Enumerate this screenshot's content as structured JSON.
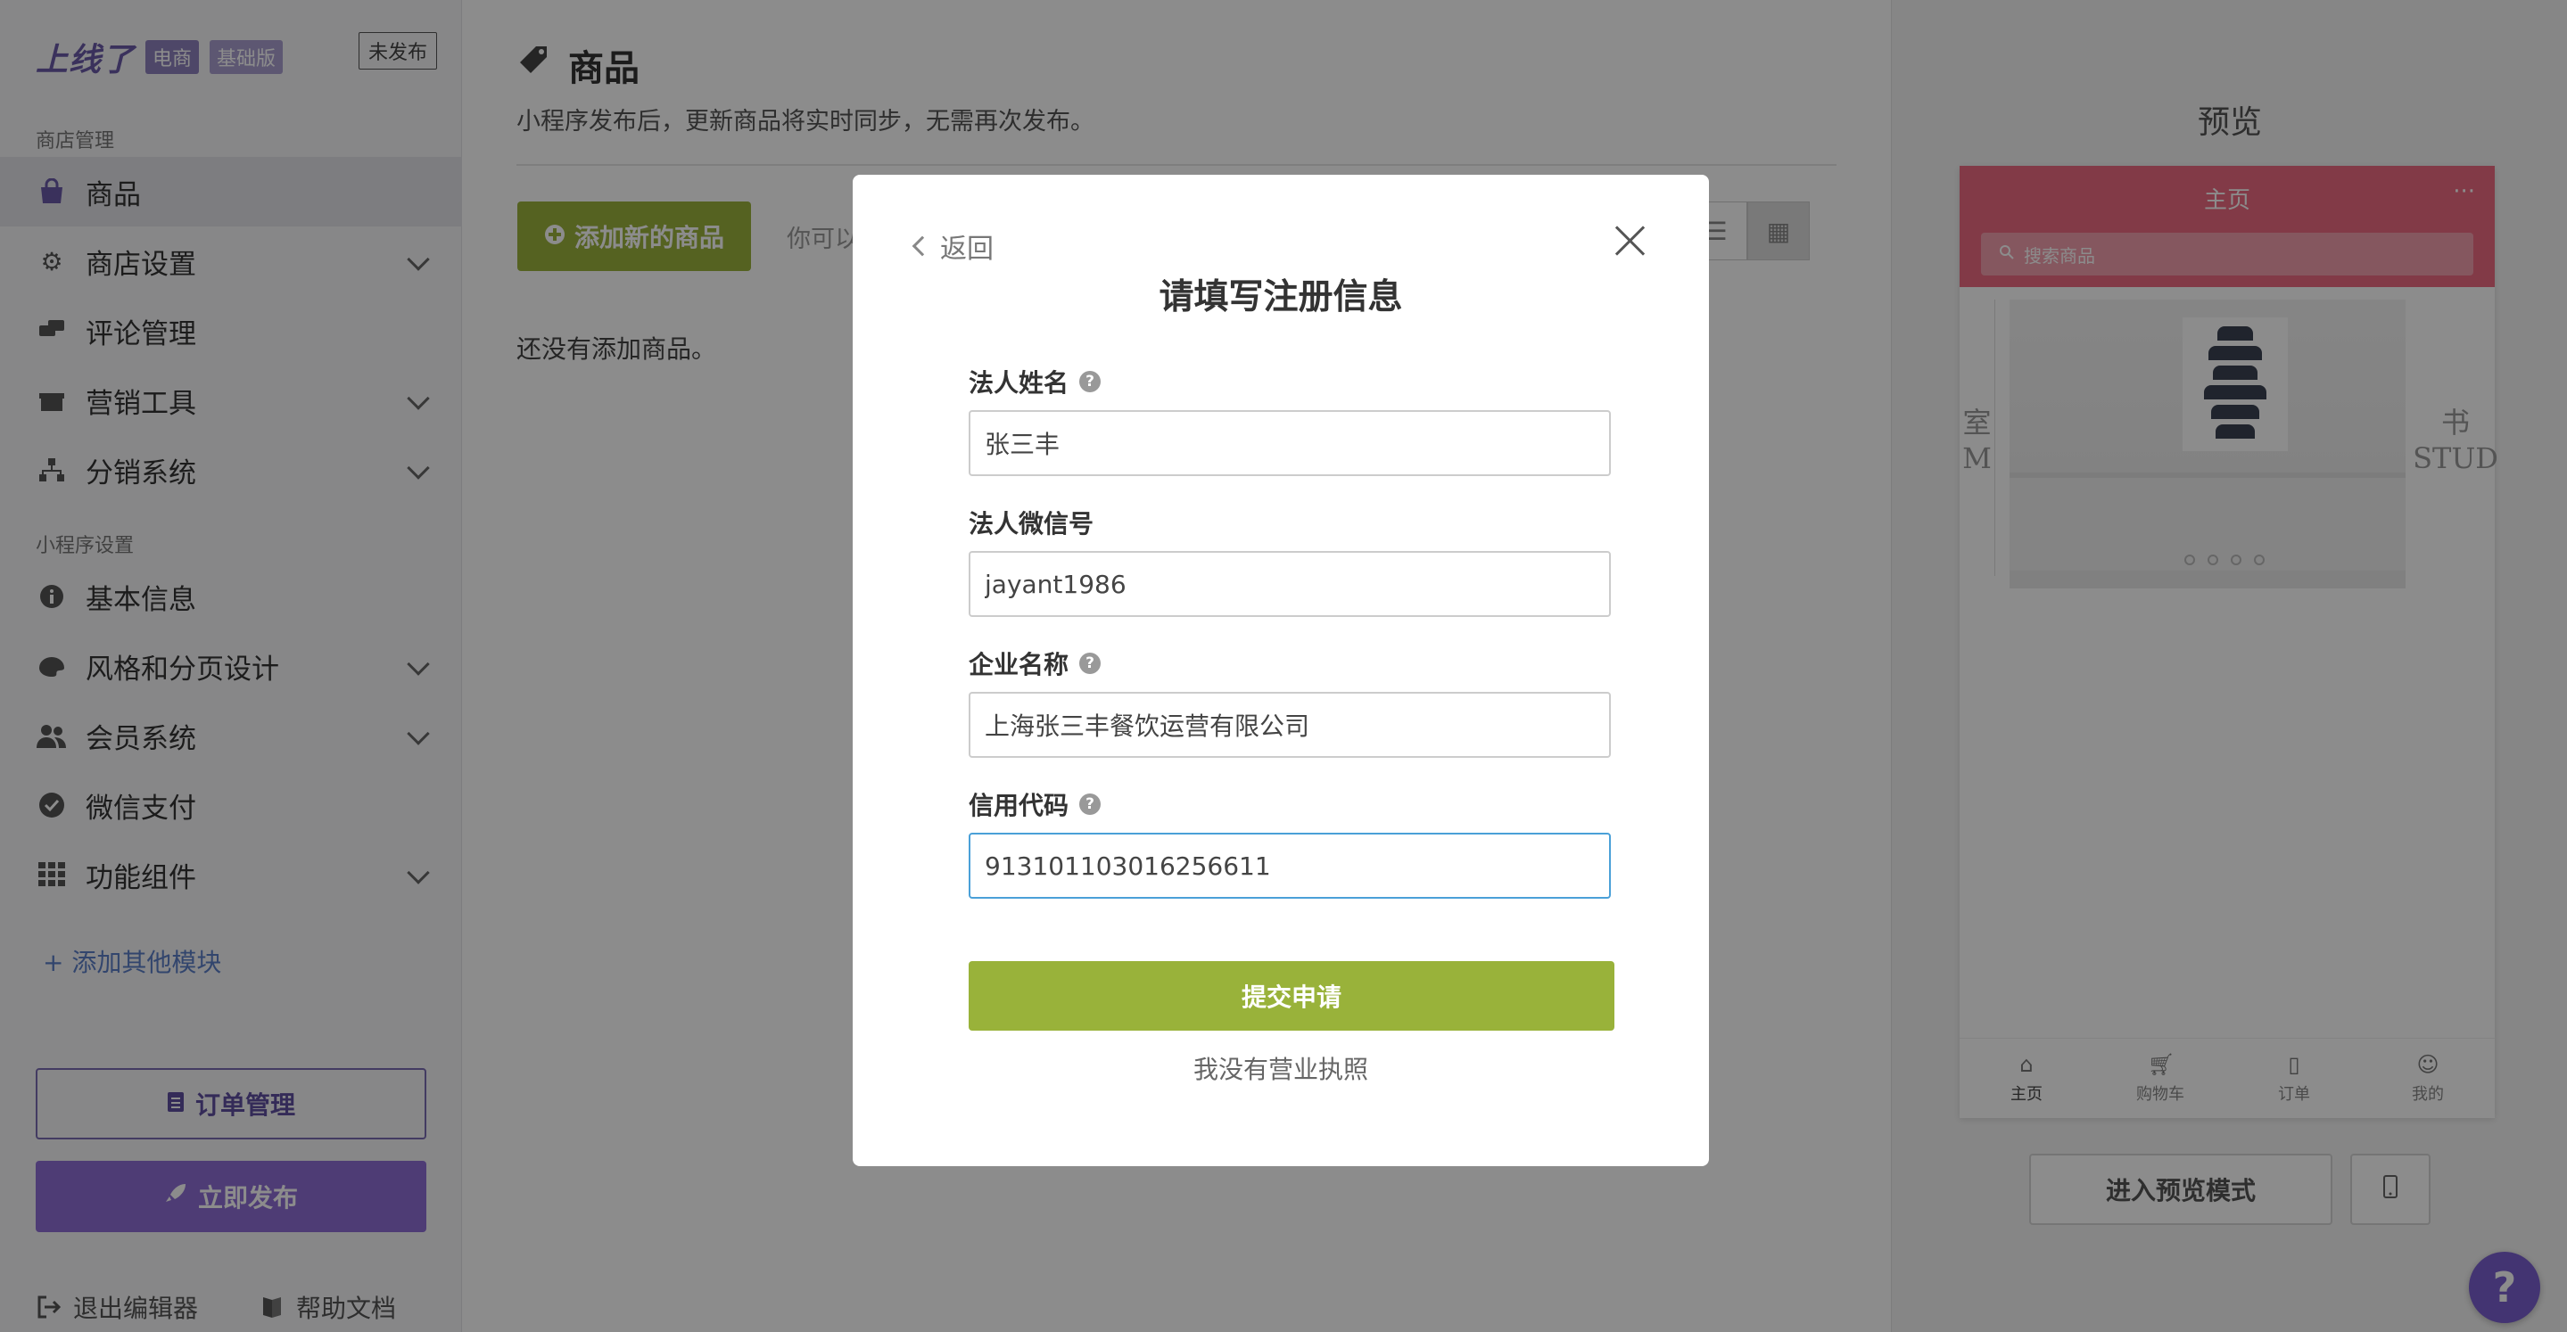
{
  "sidebar": {
    "brand": "上线了",
    "tags": [
      "电商",
      "基础版"
    ],
    "status_badge": "未发布",
    "section_store": "商店管理",
    "section_app": "小程序设置",
    "items": [
      {
        "label": "商品",
        "icon": "shopping-bag-icon"
      },
      {
        "label": "商店设置",
        "icon": "gears-icon"
      },
      {
        "label": "评论管理",
        "icon": "comments-icon"
      },
      {
        "label": "营销工具",
        "icon": "gift-icon"
      },
      {
        "label": "分销系统",
        "icon": "sitemap-icon"
      },
      {
        "label": "基本信息",
        "icon": "info-icon"
      },
      {
        "label": "风格和分页设计",
        "icon": "palette-icon"
      },
      {
        "label": "会员系统",
        "icon": "users-icon"
      },
      {
        "label": "微信支付",
        "icon": "check-circle-icon"
      },
      {
        "label": "功能组件",
        "icon": "grid-icon"
      }
    ],
    "add_module": "+ 添加其他模块",
    "orders_button": "订单管理",
    "publish_button": "立即发布",
    "exit_editor": "退出编辑器",
    "help_docs": "帮助文档"
  },
  "main": {
    "title": "商品",
    "subtitle": "小程序发布后，更新商品将实时同步，无需再次发布。",
    "add_product": "添加新的商品",
    "hint": "你可以",
    "empty": "还没有添加商品。"
  },
  "preview": {
    "title": "预览",
    "phone_title": "主页",
    "more": "···",
    "search_placeholder": "搜索商品",
    "side_left": [
      "室",
      "M"
    ],
    "side_right": [
      "书",
      "STUD"
    ],
    "tabs": [
      {
        "label": "主页",
        "icon": "home-icon"
      },
      {
        "label": "购物车",
        "icon": "cart-icon"
      },
      {
        "label": "订单",
        "icon": "document-icon"
      },
      {
        "label": "我的",
        "icon": "user-icon"
      }
    ],
    "enter_preview": "进入预览模式",
    "help_fab": "?"
  },
  "modal": {
    "back": "返回",
    "title": "请填写注册信息",
    "fields": [
      {
        "label": "法人姓名",
        "value": "张三丰",
        "help": true
      },
      {
        "label": "法人微信号",
        "value": "jayant1986",
        "help": false
      },
      {
        "label": "企业名称",
        "value": "上海张三丰餐饮运营有限公司",
        "help": true
      },
      {
        "label": "信用代码",
        "value": "913101103016256611",
        "help": true
      }
    ],
    "submit": "提交申请",
    "no_license": "我没有营业执照"
  },
  "colors": {
    "accent_green": "#99b23a",
    "accent_purple": "#8e6ed6",
    "phone_header": "#ed6a82",
    "focus_border": "#4aa0d8"
  }
}
